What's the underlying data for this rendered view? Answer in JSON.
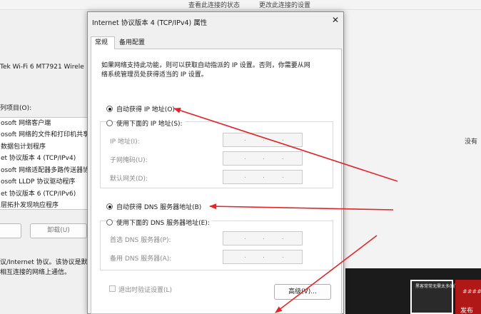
{
  "background": {
    "top_links": [
      "查看此连接的状态",
      "更改此连接的设置"
    ],
    "adapter_name": "Tek Wi-Fi 6 MT7921 Wirele",
    "items_label": "列项目(O):",
    "items": [
      "osoft 网络客户端",
      "osoft 网络的文件和打印机共享",
      "数据包计划程序",
      "et 协议版本 4 (TCP/IPv4)",
      "osoft 网络适配器多路传送器协",
      "osoft LLDP 协议驱动程序",
      "et 协议版本 6 (TCP/IPv6)",
      "层拓扑发现响应程序"
    ],
    "uninstall_button": "卸载(U)",
    "description_line1": "议/Internet 协议。该协议是默",
    "description_line2": "相互连接的网络上通信。",
    "right_text": "没有",
    "thumb_text": "发布",
    "thumb_hash": "####",
    "thumb1_text": "黑客常常无需太多的门"
  },
  "dialog": {
    "title": "Internet 协议版本 4 (TCP/IPv4) 属性",
    "close_glyph": "✕",
    "tabs": [
      "常规",
      "备用配置"
    ],
    "description": [
      "如果网络支持此功能，则可以获取自动指派的 IP 设置。否则，你需要从网",
      "络系统管理员处获得适当的 IP 设置。"
    ],
    "auto_ip": "自动获得 IP 地址(O)",
    "manual_ip": "使用下面的 IP 地址(S):",
    "ip_address_label": "IP 地址(I):",
    "subnet_label": "子网掩码(U):",
    "gateway_label": "默认网关(D):",
    "auto_dns": "自动获得 DNS 服务器地址(B)",
    "manual_dns": "使用下面的 DNS 服务器地址(E):",
    "preferred_dns_label": "首选 DNS 服务器(P):",
    "alternate_dns_label": "备用 DNS 服务器(A):",
    "ip_dot": ".",
    "validate_label": "退出时验证设置(L)",
    "advanced_button": "高级(V)..."
  },
  "colors": {
    "annotation": "#e0262b",
    "dialog_bg": "#f0f0f0",
    "panel_bg": "#ffffff"
  }
}
